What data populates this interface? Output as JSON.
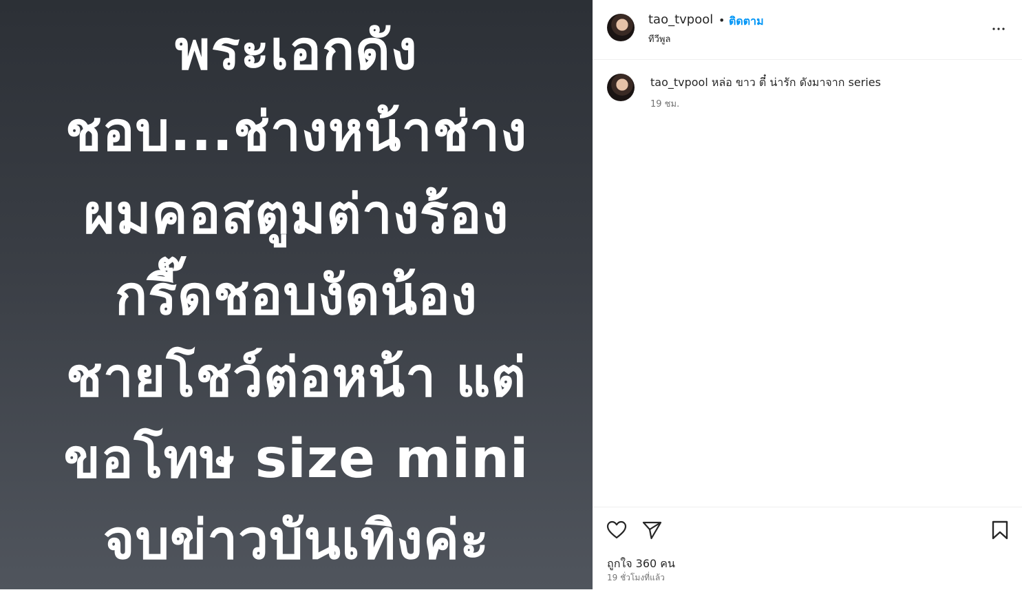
{
  "post": {
    "image_lines": [
      "พระเอกดัง",
      "ชอบ...ช่างหน้าช่าง",
      "ผมคอสตูมต่างร้อง",
      "กรี๊ดชอบงัดน้อง",
      "ชายโชว์ต่อหน้า แต่",
      "ขอโทษ size mini",
      "จบข่าวบันเทิงค่ะ"
    ]
  },
  "header": {
    "username": "tao_tvpool",
    "separator": "•",
    "follow_label": "ติดตาม",
    "subtitle": "ทีวีพูล"
  },
  "comment": {
    "username": "tao_tvpool",
    "text": "หล่อ ขาว ตี๋ น่ารัก ดังมาจาก series",
    "time": "19 ชม."
  },
  "footer": {
    "likes_label": "ถูกใจ 360 คน",
    "posted_ago": "19 ชั่วโมงที่แล้ว"
  },
  "icons": {
    "more": "more-options-icon",
    "like": "heart-icon",
    "share": "send-icon",
    "save": "bookmark-icon"
  },
  "colors": {
    "accent": "#0095f6",
    "muted": "#737373",
    "text": "#262626"
  }
}
